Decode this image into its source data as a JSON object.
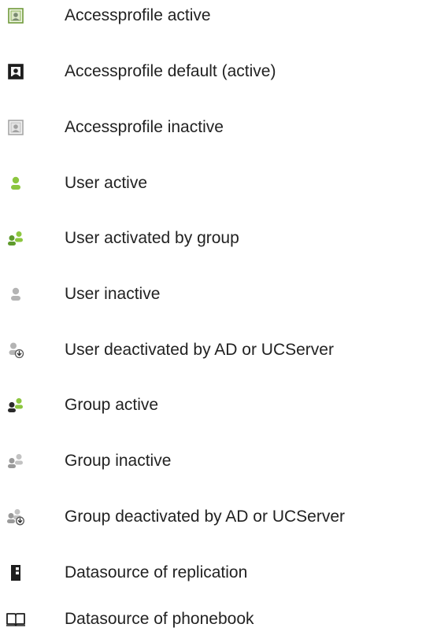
{
  "legend": {
    "items": [
      {
        "label": "Accessprofile active",
        "icon": "accessprofile-active-icon"
      },
      {
        "label": "Accessprofile default (active)",
        "icon": "accessprofile-default-icon"
      },
      {
        "label": "Accessprofile inactive",
        "icon": "accessprofile-inactive-icon"
      },
      {
        "label": "User active",
        "icon": "user-active-icon"
      },
      {
        "label": "User activated by group",
        "icon": "user-activated-by-group-icon"
      },
      {
        "label": "User inactive",
        "icon": "user-inactive-icon"
      },
      {
        "label": "User deactivated by AD or UCServer",
        "icon": "user-deactivated-icon"
      },
      {
        "label": "Group active",
        "icon": "group-active-icon"
      },
      {
        "label": "Group inactive",
        "icon": "group-inactive-icon"
      },
      {
        "label": "Group deactivated by AD or UCServer",
        "icon": "group-deactivated-icon"
      },
      {
        "label": "Datasource of replication",
        "icon": "datasource-replication-icon"
      },
      {
        "label": "Datasource of phonebook",
        "icon": "datasource-phonebook-icon"
      }
    ]
  },
  "colors": {
    "active_green": "#8cc63f",
    "inactive_gray": "#b4b4b4",
    "dark": "#2a2a2a",
    "text": "#222222"
  }
}
